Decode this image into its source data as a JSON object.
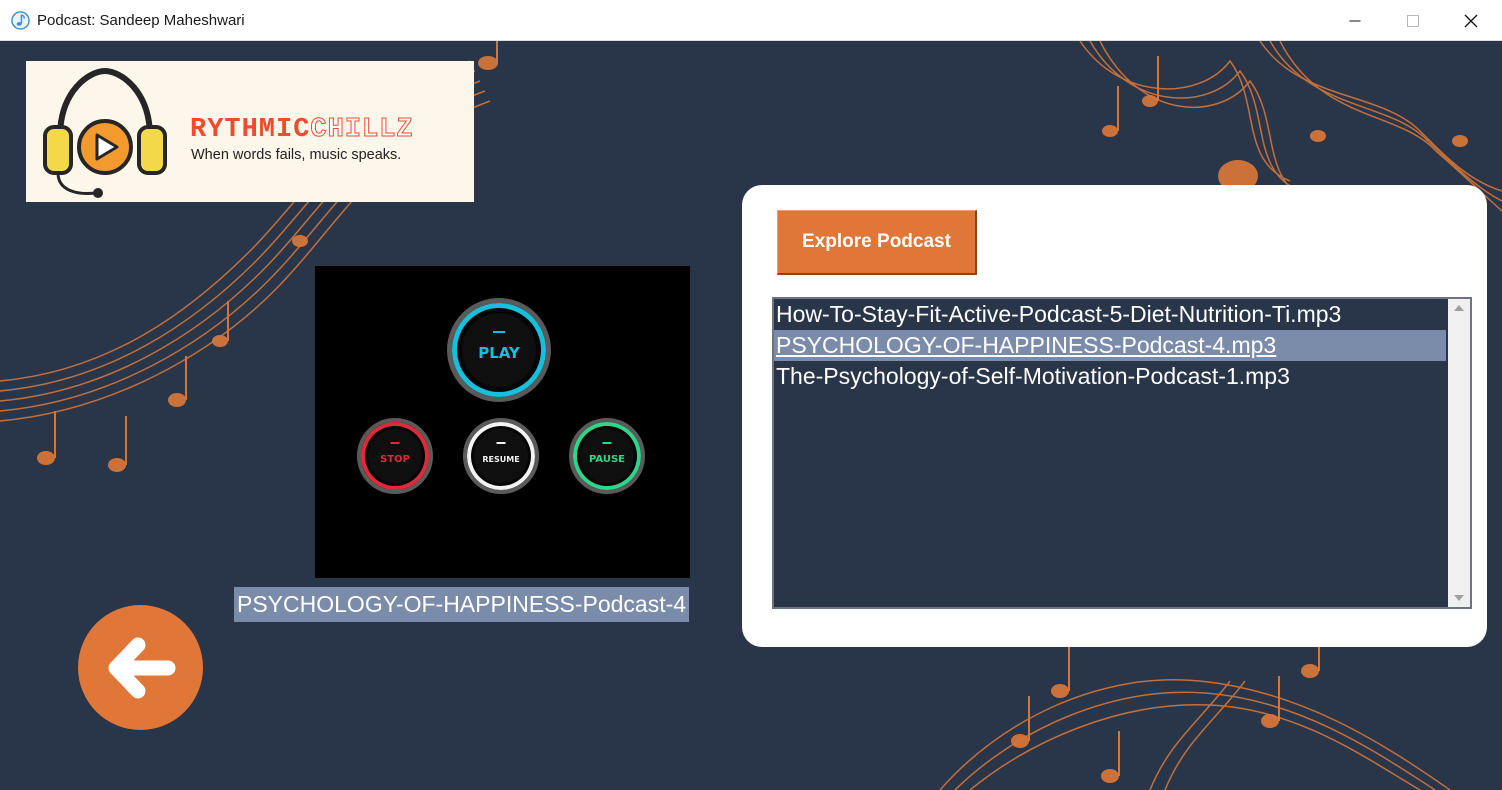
{
  "window": {
    "title": "Podcast: Sandeep Maheshwari",
    "minimize_glyph": "—",
    "maximize_glyph": "☐",
    "close_glyph": "✕"
  },
  "logo": {
    "brand_part1": "RYTHMIC",
    "brand_part2": "CHILLZ",
    "tagline": "When words fails, music speaks.",
    "icon": "headphones-play-icon"
  },
  "controls": {
    "play": "PLAY",
    "stop": "STOP",
    "resume": "RESUME",
    "pause": "PAUSE"
  },
  "now_playing": "PSYCHOLOGY-OF-HAPPINESS-Podcast-4",
  "back_button": {
    "icon": "arrow-left-icon"
  },
  "panel": {
    "explore_label": "Explore Podcast",
    "tracks": [
      "How-To-Stay-Fit-Active-Podcast-5-Diet-Nutrition-Ti.mp3",
      "PSYCHOLOGY-OF-HAPPINESS-Podcast-4.mp3",
      "The-Psychology-of-Self-Motivation-Podcast-1.mp3"
    ],
    "selected_index": 1
  },
  "colors": {
    "background": "#293548",
    "accent": "#e07637",
    "selection": "#7b8cab",
    "play_ring": "#16c0dc",
    "stop_ring": "#e02a3a",
    "resume_ring": "#f2f2f2",
    "pause_ring": "#2fd689"
  }
}
